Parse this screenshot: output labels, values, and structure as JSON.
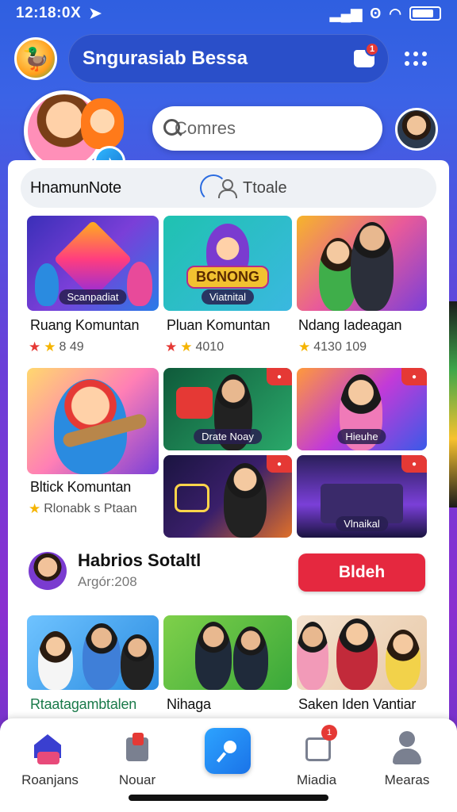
{
  "status_bar": {
    "time": "12:18:0X"
  },
  "header": {
    "title": "Sngurasiab Bessa",
    "notification_count": "1"
  },
  "search": {
    "placeholder": "Comres"
  },
  "card": {
    "label": "HnamunNote",
    "toggle_text": "Ttoale"
  },
  "tiles": [
    {
      "caption": "Ruang Komuntan",
      "rating": "8 49",
      "banner": "Scanpadiat"
    },
    {
      "caption": "Pluan Komuntan",
      "rating": "4010",
      "banner": "BCNONG",
      "banner_sub": "Viatnital"
    },
    {
      "caption": "Ndang Iadeagan",
      "rating": "4130 109"
    },
    {
      "caption": "Bltick Komuntan",
      "rating": "Rlonabk s Ptaan"
    },
    {
      "banner": "Drate Noay"
    },
    {
      "banner": "Hieuhe"
    },
    {
      "banner": ""
    },
    {
      "banner": "Vlnaikal"
    }
  ],
  "follow": {
    "title": "Habrios Sotaltl",
    "subtitle": "Argór:208",
    "button_label": "Bldeh"
  },
  "bottom_row": [
    {
      "caption": "Rtaatagambtalen"
    },
    {
      "caption": "Nihaga"
    },
    {
      "caption": "Saken Iden Vantiar"
    }
  ],
  "nav": {
    "items": [
      {
        "label": "Roanjans"
      },
      {
        "label": "Nouar"
      },
      {
        "label": ""
      },
      {
        "label": "Miadia",
        "badge": "1"
      },
      {
        "label": "Mearas"
      }
    ]
  },
  "colors": {
    "primary": "#2a4fc9",
    "accent_red": "#e5283f",
    "background_purple": "#8a2fd0"
  }
}
